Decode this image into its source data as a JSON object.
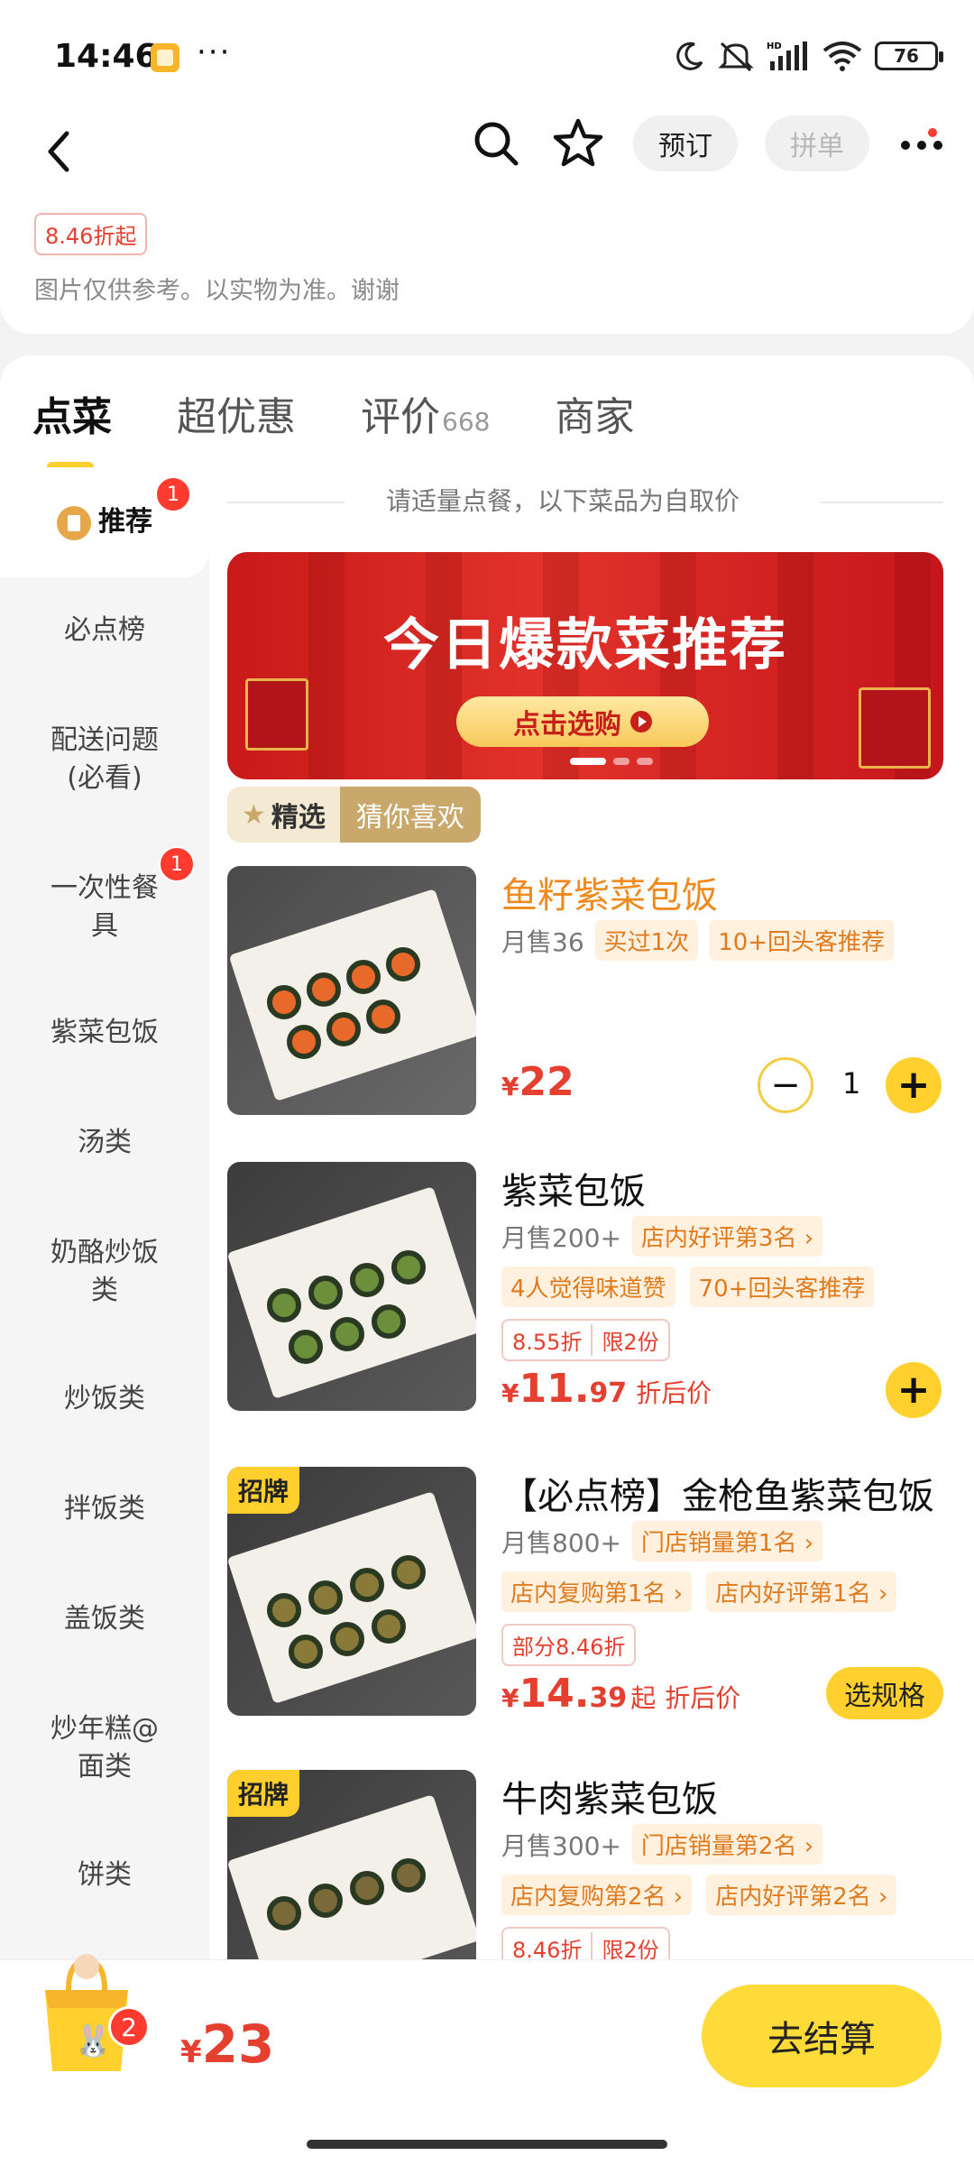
{
  "status_bar": {
    "time": "14:46",
    "more": "···",
    "battery": "76"
  },
  "header": {
    "reserve_label": "预订",
    "group_label": "拼单",
    "discount_tag": "8.46折起",
    "notice": "图片仅供参考。以实物为准。谢谢"
  },
  "tabs": [
    {
      "label": "点菜"
    },
    {
      "label": "超优惠"
    },
    {
      "label": "评价",
      "count": "668"
    },
    {
      "label": "商家"
    }
  ],
  "sidebar": {
    "items": [
      {
        "label": "推荐",
        "badge": "1"
      },
      {
        "label": "必点榜"
      },
      {
        "label": "配送问题\n(必看)"
      },
      {
        "label": "一次性餐\n具",
        "badge": "1"
      },
      {
        "label": "紫菜包饭"
      },
      {
        "label": "汤类"
      },
      {
        "label": "奶酪炒饭\n类"
      },
      {
        "label": "炒饭类"
      },
      {
        "label": "拌饭类"
      },
      {
        "label": "盖饭类"
      },
      {
        "label": "炒年糕@\n面类"
      },
      {
        "label": "饼类"
      }
    ]
  },
  "content": {
    "hint": "请适量点餐，以下菜品为自取价",
    "banner": {
      "title": "今日爆款菜推荐",
      "button": "点击选购"
    },
    "segment": {
      "selected": "精选",
      "other": "猜你喜欢"
    }
  },
  "dishes": [
    {
      "name": "鱼籽紫菜包饭",
      "sales": "月售36",
      "tags": [
        "买过1次",
        "10+回头客推荐"
      ],
      "price_symbol": "¥",
      "price": "22",
      "qty": "1"
    },
    {
      "name": "紫菜包饭",
      "sales": "月售200+",
      "tags": [
        "店内好评第3名 ›"
      ],
      "tags2": [
        "4人觉得味道赞",
        "70+回头客推荐"
      ],
      "discount": "8.55折",
      "limit": "限2份",
      "price_symbol": "¥",
      "price_int": "11.",
      "price_dec": "97",
      "after": "折后价"
    },
    {
      "badge": "招牌",
      "name": "【必点榜】金枪鱼紫菜包饭",
      "sales": "月售800+",
      "tags": [
        "门店销量第1名 ›"
      ],
      "tags2": [
        "店内复购第1名 ›",
        "店内好评第1名 ›"
      ],
      "discount": "部分8.46折",
      "price_symbol": "¥",
      "price_int": "14.",
      "price_dec": "39",
      "from": "起",
      "after": "折后价",
      "spec": "选规格"
    },
    {
      "badge": "招牌",
      "name": "牛肉紫菜包饭",
      "sales": "月售300+",
      "tags": [
        "门店销量第2名 ›"
      ],
      "tags2": [
        "店内复购第2名 ›",
        "店内好评第2名 ›"
      ],
      "discount": "8.46折",
      "limit": "限2份"
    }
  ],
  "cart": {
    "count": "2",
    "currency": "¥",
    "total": "23",
    "checkout": "去结算"
  }
}
